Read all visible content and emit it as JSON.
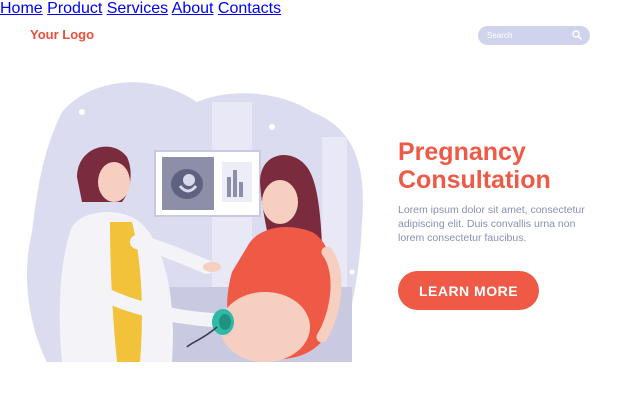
{
  "header": {
    "logo_text": "Your Logo",
    "nav": [
      {
        "label": "Home",
        "active": true
      },
      {
        "label": "Product",
        "active": false
      },
      {
        "label": "Services",
        "active": false
      },
      {
        "label": "About",
        "active": false
      },
      {
        "label": "Contacts",
        "active": false
      }
    ],
    "search": {
      "placeholder": "Search",
      "icon": "search-icon"
    }
  },
  "hero": {
    "title_line1": "Pregnancy",
    "title_line2": "Consultation",
    "description_line1": "Lorem ipsum dolor sit amet, consectetur",
    "description_line2": "adipiscing elit. Duis convallis urna non",
    "description_line3": "lorem consectetur faucibus.",
    "cta_label": "LEARN MORE"
  },
  "colors": {
    "accent": "#ee5a45",
    "nav_text": "#8a8fa6",
    "search_bg": "#cfd4ec",
    "illustration_bg": "#dcdcf0"
  }
}
